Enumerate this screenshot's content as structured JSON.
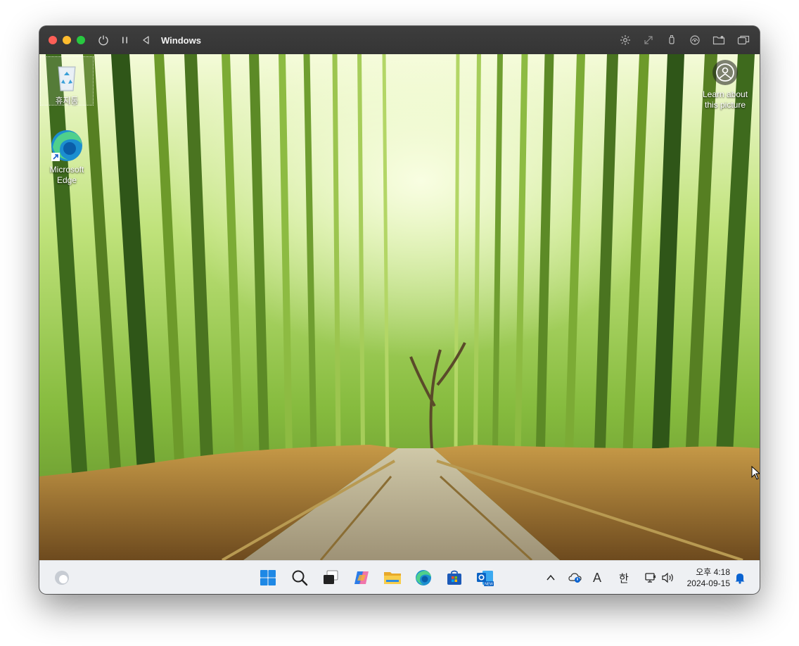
{
  "window": {
    "title": "Windows"
  },
  "desktop": {
    "icons": [
      {
        "label": "휴지통",
        "icon": "recycle-bin-icon"
      },
      {
        "label": "Microsoft Edge",
        "icon": "edge-icon"
      }
    ],
    "spotlight": {
      "label_line1": "Learn about",
      "label_line2": "this picture",
      "icon": "camera-icon"
    }
  },
  "taskbar": {
    "pinned": [
      "start-icon",
      "search-icon",
      "task-view-icon",
      "copilot-icon",
      "file-explorer-icon",
      "edge-icon",
      "store-icon",
      "outlook-icon"
    ],
    "tray": {
      "input_mode": "A",
      "ime": "한",
      "time": "오후 4:18",
      "date": "2024-09-15"
    }
  },
  "colors": {
    "titlebar": "#3a3a3a",
    "taskbar": "#eef0f3",
    "accent": "#0a63d1"
  }
}
